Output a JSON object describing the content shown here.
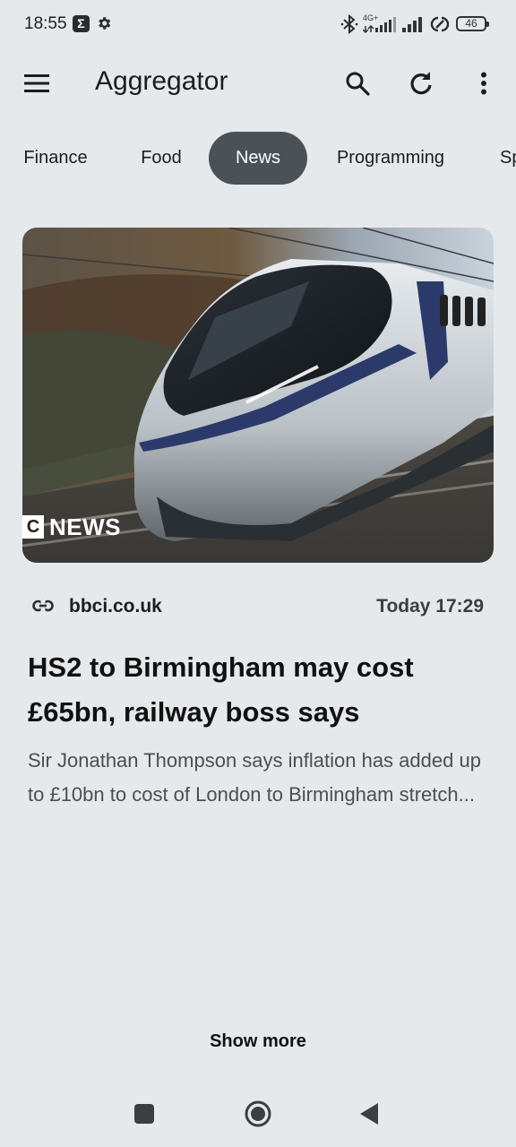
{
  "status_bar": {
    "time": "18:55",
    "network_label": "4G+",
    "battery": "46",
    "icons": [
      "sigma-icon",
      "gear-icon",
      "bluetooth-icon",
      "signal-icon",
      "signal-icon",
      "link-icon",
      "battery-icon"
    ]
  },
  "app_bar": {
    "title": "Aggregator",
    "icons": [
      "menu-icon",
      "search-icon",
      "refresh-icon",
      "more-vert-icon"
    ]
  },
  "tabs": [
    {
      "label": "Finance",
      "active": false
    },
    {
      "label": "Food",
      "active": false
    },
    {
      "label": "News",
      "active": true
    },
    {
      "label": "Programming",
      "active": false
    },
    {
      "label": "Sp",
      "active": false
    }
  ],
  "article": {
    "image_logo_text": "NEWS",
    "image_logo_letter": "C",
    "source": "bbci.co.uk",
    "timestamp": "Today 17:29",
    "headline": "HS2 to Birmingham may cost £65bn, railway boss says",
    "summary": "Sir Jonathan Thompson says inflation has added up to £10bn to cost of London to Birmingham stretch..."
  },
  "show_more_label": "Show more",
  "colors": {
    "background": "#e5e9ec",
    "active_tab": "#4a5257",
    "text": "#1b1d1f"
  }
}
